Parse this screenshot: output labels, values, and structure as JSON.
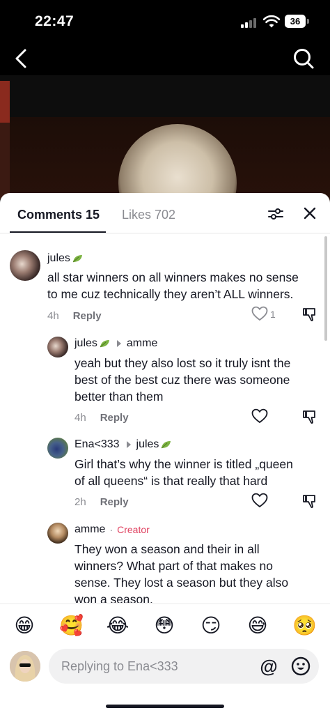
{
  "status_bar": {
    "time": "22:47",
    "battery": "36"
  },
  "tabs": {
    "comments_label": "Comments 15",
    "likes_label": "Likes 702"
  },
  "comments": [
    {
      "username": "jules",
      "text_lines": [
        "all star winners on all winners makes no sense",
        "to me cuz technically they aren’t ALL winners."
      ],
      "time": "4h",
      "reply_label": "Reply",
      "likes": "1"
    },
    {
      "username": "jules",
      "reply_to": "amme",
      "text_lines": [
        "yeah but they also lost so it truly isnt the",
        "best of the best cuz there was someone",
        "better than them"
      ],
      "time": "4h",
      "reply_label": "Reply"
    },
    {
      "username": "Ena<333",
      "reply_to": "jules",
      "text_lines": [
        "Girl that’s why the winner is titled „queen",
        "of all queens“ is that really that hard"
      ],
      "time": "2h",
      "reply_label": "Reply"
    },
    {
      "username": "amme",
      "badge_separator": "·",
      "badge": "Creator",
      "text_lines": [
        "They won a season and their in all",
        "winners? What part of that makes no",
        "sense. They lost a season but they also",
        "won a season."
      ]
    }
  ],
  "emojis": [
    "😁",
    "🥰",
    "😂",
    "😳",
    "😏",
    "😅",
    "🥺"
  ],
  "reply_box": {
    "placeholder": "Replying to Ena<333",
    "at_symbol": "@"
  }
}
